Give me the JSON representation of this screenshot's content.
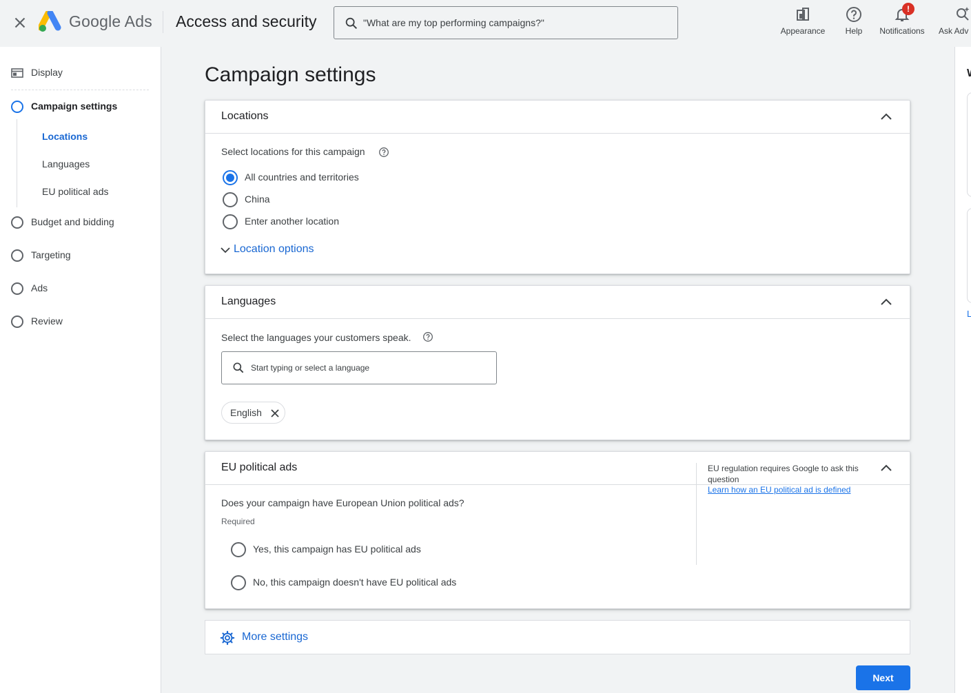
{
  "topbar": {
    "brand": "Google Ads",
    "page_heading": "Access and security",
    "search_placeholder": "\"What are my top performing campaigns?\"",
    "tools": {
      "appearance": "Appearance",
      "help": "Help",
      "notifications": "Notifications",
      "notifications_badge": "!",
      "ask_advisor": "Ask Adv"
    },
    "icons": [
      "close-icon",
      "google-ads-logo",
      "search-icon",
      "appearance-icon",
      "help-icon",
      "bell-icon",
      "ask-advisor-icon"
    ]
  },
  "sidebar": {
    "items": [
      {
        "label": "Display",
        "icon": "display-icon"
      },
      {
        "label": "Campaign settings",
        "icon": "step-ring-icon",
        "active": true
      },
      {
        "label": "Budget and bidding",
        "icon": "step-ring-icon"
      },
      {
        "label": "Targeting",
        "icon": "step-ring-icon"
      },
      {
        "label": "Ads",
        "icon": "step-ring-icon"
      },
      {
        "label": "Review",
        "icon": "step-ring-icon"
      }
    ],
    "sub_items": [
      {
        "label": "Locations",
        "active": true
      },
      {
        "label": "Languages"
      },
      {
        "label": "EU political ads"
      }
    ]
  },
  "main": {
    "title": "Campaign settings",
    "locations": {
      "title": "Locations",
      "prompt": "Select locations for this campaign",
      "options": [
        {
          "label": "All countries and territories",
          "checked": true
        },
        {
          "label": "China",
          "checked": false
        },
        {
          "label": "Enter another location",
          "checked": false
        }
      ],
      "location_options_link": "Location options"
    },
    "languages": {
      "title": "Languages",
      "prompt": "Select the languages your customers speak.",
      "input_placeholder": "Start typing or select a language",
      "chips": [
        "English"
      ]
    },
    "eu_political": {
      "title": "EU political ads",
      "question": "Does your campaign have European Union political ads?",
      "required": "Required",
      "options": [
        {
          "label": "Yes, this campaign has EU political ads",
          "checked": false
        },
        {
          "label": "No, this campaign doesn't have EU political ads",
          "checked": false
        }
      ],
      "note": "EU regulation requires Google to ask this question",
      "note_link": "Learn how an EU political ad is defined"
    },
    "more_settings": "More settings",
    "next_button": "Next"
  },
  "right_panel": {
    "heading": "W",
    "link": "L"
  },
  "colors": {
    "accent": "#1a73e8",
    "link": "#1967d2",
    "badge": "#d93025",
    "background": "#f1f3f4"
  }
}
